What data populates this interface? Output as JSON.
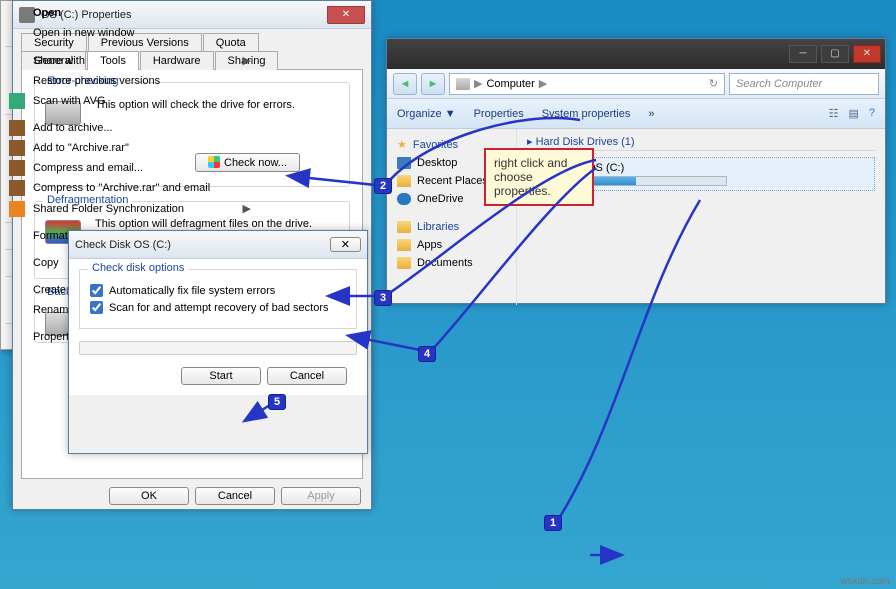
{
  "props": {
    "title": "OS (C:) Properties",
    "tabs_row1": [
      "Security",
      "Previous Versions",
      "Quota"
    ],
    "tabs_row2": [
      "General",
      "Tools",
      "Hardware",
      "Sharing"
    ],
    "active_tab": "Tools",
    "errchk": {
      "title": "Error-checking",
      "text": "This option will check the drive for errors.",
      "btn": "Check now..."
    },
    "defrag": {
      "title": "Defragmentation",
      "text": "This option will defragment files on the drive."
    },
    "backup": {
      "title": "Backup"
    },
    "buttons": {
      "ok": "OK",
      "cancel": "Cancel",
      "apply": "Apply"
    }
  },
  "chkdsk": {
    "title": "Check Disk OS (C:)",
    "group": "Check disk options",
    "cb1": "Automatically fix file system errors",
    "cb2": "Scan for and attempt recovery of bad sectors",
    "start": "Start",
    "cancel": "Cancel"
  },
  "explorer": {
    "addr": "Computer",
    "breadcrumb_arrow": "▶",
    "search_ph": "Search Computer",
    "cmds": {
      "organize": "Organize ▼",
      "properties": "Properties",
      "sysprops": "System properties",
      "more": "»"
    },
    "sidebar": {
      "favorites": "Favorites",
      "desktop": "Desktop",
      "recent": "Recent Places",
      "onedrive": "OneDrive",
      "libraries": "Libraries",
      "apps": "Apps",
      "documents": "Documents"
    },
    "section": "Hard Disk Drives (1)",
    "drive": "OS (C:)"
  },
  "ctx": {
    "open": "Open",
    "opennew": "Open in new window",
    "share": "Share with",
    "restore": "Restore previous versions",
    "scan": "Scan with AVG",
    "arch": "Add to archive...",
    "archrar": "Add to \"Archive.rar\"",
    "compmail": "Compress and email...",
    "comprar": "Compress to \"Archive.rar\" and email",
    "sync": "Shared Folder Synchronization",
    "format": "Format...",
    "copy": "Copy",
    "shortcut": "Create shortcut",
    "rename": "Rename",
    "properties": "Properties"
  },
  "annot": {
    "tooltip": "right click and choose properties."
  },
  "credit": "wsxdn.com"
}
